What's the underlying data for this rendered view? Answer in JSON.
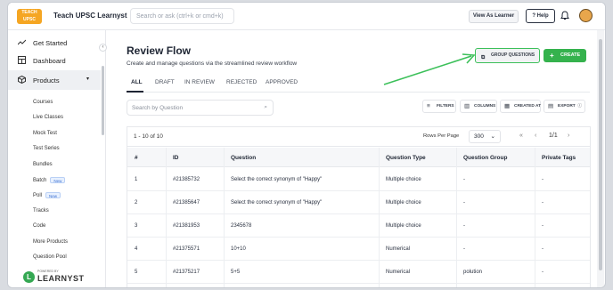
{
  "app": {
    "title": "Teach UPSC Learnyst",
    "logo_text": "TEACH UPSC"
  },
  "search": {
    "placeholder": "Search or ask (ctrl+k or cmd+k)"
  },
  "header": {
    "view_as_learner": "View As Learner",
    "help": "Help"
  },
  "sidebar": {
    "items": [
      {
        "label": "Get Started",
        "icon": "trend-icon"
      },
      {
        "label": "Dashboard",
        "icon": "dashboard-icon"
      },
      {
        "label": "Products",
        "icon": "box-icon"
      }
    ],
    "sub_items": [
      {
        "label": "Courses"
      },
      {
        "label": "Live Classes"
      },
      {
        "label": "Mock Test"
      },
      {
        "label": "Test Series"
      },
      {
        "label": "Bundles"
      },
      {
        "label": "Batch",
        "badge": "New"
      },
      {
        "label": "Poll",
        "badge": "New"
      },
      {
        "label": "Tracks"
      },
      {
        "label": "Code"
      },
      {
        "label": "More Products"
      },
      {
        "label": "Question Pool"
      }
    ],
    "brand": {
      "powered_by": "POWERED BY",
      "name": "LEARNYST"
    }
  },
  "page": {
    "title": "Review Flow",
    "description": "Create and manage questions via the streamlined review workflow",
    "group_questions": "GROUP QUESTIONS",
    "create": "CREATE"
  },
  "tabs": [
    "ALL",
    "DRAFT",
    "IN REVIEW",
    "REJECTED",
    "APPROVED"
  ],
  "question_search": {
    "placeholder": "Search by Question"
  },
  "toolbar": {
    "filters": "FILTERS",
    "columns": "COLUMNS",
    "created_at": "CREATED AT",
    "export": "EXPORT"
  },
  "table": {
    "count": "1 - 10 of 10",
    "rows_per_page_label": "Rows Per Page",
    "rows_per_page": "300",
    "page": "1/1",
    "columns": [
      "#",
      "ID",
      "Question",
      "Question Type",
      "Question Group",
      "Private Tags"
    ],
    "rows": [
      [
        "1",
        "#21385732",
        "Select the correct synonym of \"Happy\"",
        "Multiple choice",
        "-",
        "-"
      ],
      [
        "2",
        "#21385647",
        "Select the correct synonym of \"Happy\"",
        "Multiple choice",
        "-",
        "-"
      ],
      [
        "3",
        "#21381953",
        "2345678",
        "Multiple choice",
        "-",
        "-"
      ],
      [
        "4",
        "#21375571",
        "10+10",
        "Numerical",
        "-",
        "-"
      ],
      [
        "5",
        "#21375217",
        "5+5",
        "Numerical",
        "polution",
        "-"
      ]
    ]
  },
  "colors": {
    "accent_green": "#35b24d",
    "highlight_green": "#3cc05a",
    "logo": "#f5a623"
  }
}
